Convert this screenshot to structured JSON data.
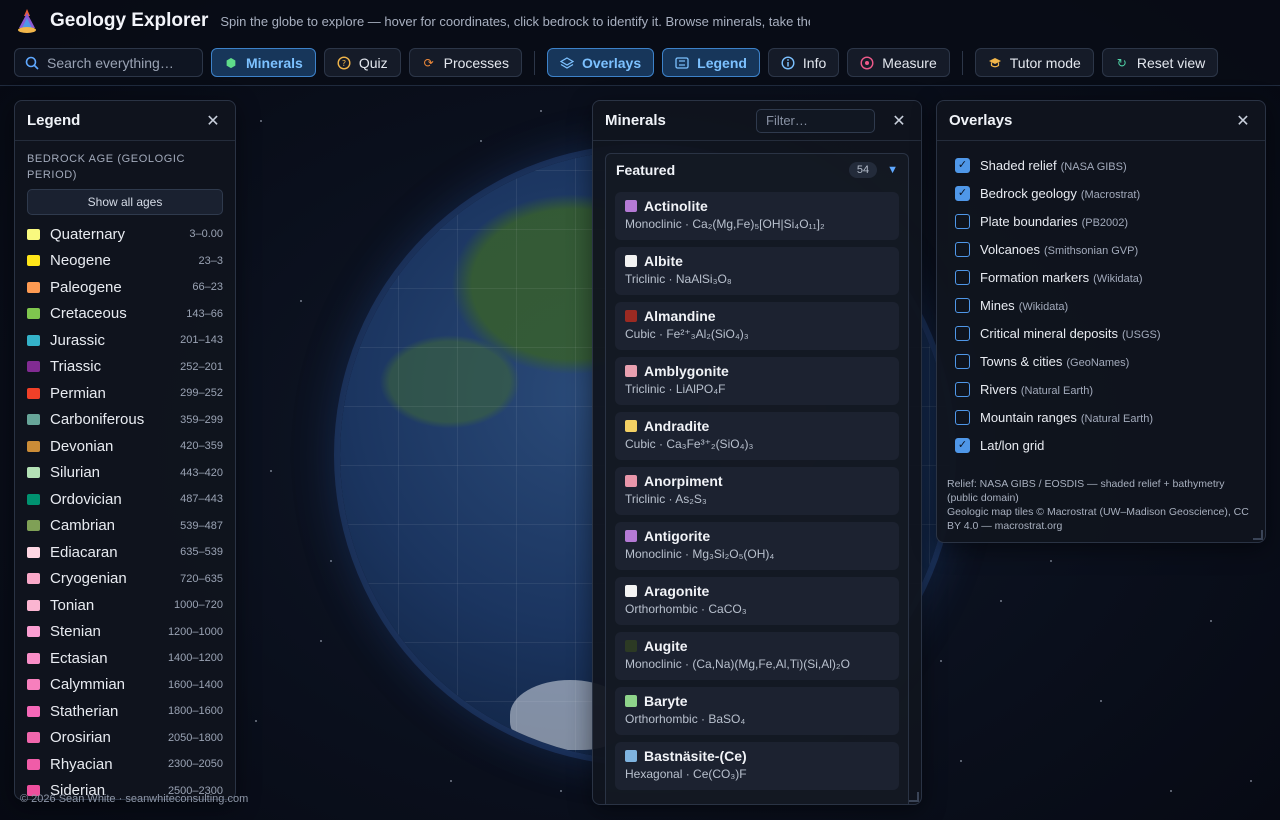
{
  "app": {
    "title": "Geology Explorer",
    "subtitle": "Spin the globe to explore — hover for coordinates, click bedrock to identify it. Browse minerals, take the …"
  },
  "toolbar": {
    "search_placeholder": "Search everything…",
    "buttons": [
      {
        "label": "Minerals",
        "icon": "cube-icon",
        "active": true
      },
      {
        "label": "Quiz",
        "icon": "question-icon",
        "active": false
      },
      {
        "label": "Processes",
        "icon": "cycle-icon",
        "active": false
      },
      {
        "label": "Overlays",
        "icon": "layers-icon",
        "active": true
      },
      {
        "label": "Legend",
        "icon": "legend-icon",
        "active": true
      },
      {
        "label": "Info",
        "icon": "info-icon",
        "active": false
      },
      {
        "label": "Measure",
        "icon": "measure-icon",
        "active": false
      },
      {
        "label": "Tutor mode",
        "icon": "graduation-cap-icon",
        "active": false
      },
      {
        "label": "Reset view",
        "icon": "reset-icon",
        "active": false
      }
    ]
  },
  "legend": {
    "title": "Legend",
    "section": "BEDROCK AGE (GEOLOGIC PERIOD)",
    "show_all": "Show all ages",
    "items": [
      {
        "name": "Quaternary",
        "range": "3–0.00",
        "color": "#f9f97f"
      },
      {
        "name": "Neogene",
        "range": "23–3",
        "color": "#ffe619"
      },
      {
        "name": "Paleogene",
        "range": "66–23",
        "color": "#fd9a52"
      },
      {
        "name": "Cretaceous",
        "range": "143–66",
        "color": "#7fc64e"
      },
      {
        "name": "Jurassic",
        "range": "201–143",
        "color": "#34b2c9"
      },
      {
        "name": "Triassic",
        "range": "252–201",
        "color": "#812b92"
      },
      {
        "name": "Permian",
        "range": "299–252",
        "color": "#f04028"
      },
      {
        "name": "Carboniferous",
        "range": "359–299",
        "color": "#67a599"
      },
      {
        "name": "Devonian",
        "range": "420–359",
        "color": "#cb8c37"
      },
      {
        "name": "Silurian",
        "range": "443–420",
        "color": "#b3e1b6"
      },
      {
        "name": "Ordovician",
        "range": "487–443",
        "color": "#009270"
      },
      {
        "name": "Cambrian",
        "range": "539–487",
        "color": "#7fa056"
      },
      {
        "name": "Ediacaran",
        "range": "635–539",
        "color": "#fed6e3"
      },
      {
        "name": "Cryogenian",
        "range": "720–635",
        "color": "#f9a8c8"
      },
      {
        "name": "Tonian",
        "range": "1000–720",
        "color": "#fbb5d1"
      },
      {
        "name": "Stenian",
        "range": "1200–1000",
        "color": "#fb9ed2"
      },
      {
        "name": "Ectasian",
        "range": "1400–1200",
        "color": "#f98ec7"
      },
      {
        "name": "Calymmian",
        "range": "1600–1400",
        "color": "#f77fbd"
      },
      {
        "name": "Statherian",
        "range": "1800–1600",
        "color": "#f568b8"
      },
      {
        "name": "Orosirian",
        "range": "2050–1800",
        "color": "#f066ac"
      },
      {
        "name": "Rhyacian",
        "range": "2300–2050",
        "color": "#f05ca8"
      },
      {
        "name": "Siderian",
        "range": "2500–2300",
        "color": "#ee4f9e"
      }
    ]
  },
  "minerals": {
    "title": "Minerals",
    "filter_placeholder": "Filter…",
    "group": "Featured",
    "count": "54",
    "items": [
      {
        "name": "Actinolite",
        "detail": "Monoclinic · Ca₂(Mg,Fe)₅[OH|Si₄O₁₁]₂",
        "color": "#b57ad6"
      },
      {
        "name": "Albite",
        "detail": "Triclinic · NaAlSi₃O₈",
        "color": "#f2f2f2"
      },
      {
        "name": "Almandine",
        "detail": "Cubic · Fe²⁺₃Al₂(SiO₄)₃",
        "color": "#9c2a22"
      },
      {
        "name": "Amblygonite",
        "detail": "Triclinic · LiAlPO₄F",
        "color": "#e8a0b0"
      },
      {
        "name": "Andradite",
        "detail": "Cubic · Ca₃Fe³⁺₂(SiO₄)₃",
        "color": "#f3d064"
      },
      {
        "name": "Anorpiment",
        "detail": "Triclinic · As₂S₃",
        "color": "#e896aa"
      },
      {
        "name": "Antigorite",
        "detail": "Monoclinic · Mg₃Si₂O₅(OH)₄",
        "color": "#b57ad6"
      },
      {
        "name": "Aragonite",
        "detail": "Orthorhombic · CaCO₃",
        "color": "#f4f4f4"
      },
      {
        "name": "Augite",
        "detail": "Monoclinic · (Ca,Na)(Mg,Fe,Al,Ti)(Si,Al)₂O",
        "color": "#2c3a24"
      },
      {
        "name": "Baryte",
        "detail": "Orthorhombic · BaSO₄",
        "color": "#8ed48a"
      },
      {
        "name": "Bastnäsite-(Ce)",
        "detail": "Hexagonal · Ce(CO₃)F",
        "color": "#7fb4e0"
      }
    ]
  },
  "overlays": {
    "title": "Overlays",
    "items": [
      {
        "name": "Shaded relief",
        "source": "(NASA GIBS)",
        "checked": true
      },
      {
        "name": "Bedrock geology",
        "source": "(Macrostrat)",
        "checked": true
      },
      {
        "name": "Plate boundaries",
        "source": "(PB2002)",
        "checked": false
      },
      {
        "name": "Volcanoes",
        "source": "(Smithsonian GVP)",
        "checked": false
      },
      {
        "name": "Formation markers",
        "source": "(Wikidata)",
        "checked": false
      },
      {
        "name": "Mines",
        "source": "(Wikidata)",
        "checked": false
      },
      {
        "name": "Critical mineral deposits",
        "source": "(USGS)",
        "checked": false
      },
      {
        "name": "Towns & cities",
        "source": "(GeoNames)",
        "checked": false
      },
      {
        "name": "Rivers",
        "source": "(Natural Earth)",
        "checked": false
      },
      {
        "name": "Mountain ranges",
        "source": "(Natural Earth)",
        "checked": false
      },
      {
        "name": "Lat/lon grid",
        "source": "",
        "checked": true
      }
    ],
    "attribution_1": "Relief: NASA GIBS / EOSDIS — shaded relief + bathymetry (public domain)",
    "attribution_2": "Geologic map tiles © Macrostrat (UW–Madison Geoscience), CC BY 4.0 — macrostrat.org"
  },
  "footer": "© 2026 Sean White · seanwhiteconsulting.com"
}
